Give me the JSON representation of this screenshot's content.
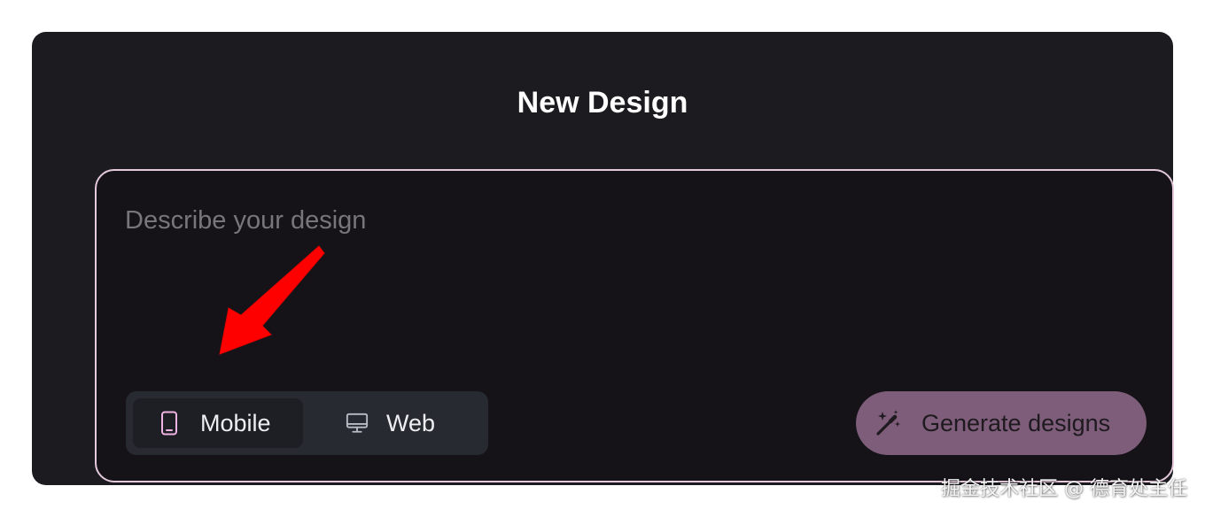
{
  "dialog": {
    "title": "New Design"
  },
  "prompt": {
    "placeholder": "Describe your design",
    "value": ""
  },
  "device_toggle": {
    "selected": "Mobile",
    "options": [
      {
        "label": "Mobile",
        "icon": "smartphone-icon"
      },
      {
        "label": "Web",
        "icon": "monitor-icon"
      }
    ]
  },
  "generate_button": {
    "label": "Generate designs",
    "icon": "magic-wand-icon"
  },
  "annotation": {
    "icon": "red-arrow-annotation"
  },
  "watermark": {
    "text": "掘金技术社区 @ 德育处主任"
  },
  "colors": {
    "dialog_background": "#1c1c20",
    "prompt_border": "#e4c8dc",
    "toggle_background": "#272a31",
    "mobile_icon": "#f0b4e4",
    "generate_button": "#7d5d79",
    "arrow": "#ff0000"
  }
}
